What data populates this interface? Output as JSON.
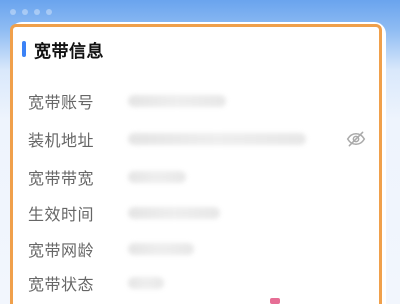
{
  "section": {
    "title": "宽带信息"
  },
  "rows": [
    {
      "label": "宽带账号"
    },
    {
      "label": "装机地址",
      "icon": "eye-hidden-icon"
    },
    {
      "label": "宽带带宽"
    },
    {
      "label": "生效时间"
    },
    {
      "label": "宽带网龄"
    },
    {
      "label": "宽带状态"
    }
  ],
  "colors": {
    "accent": "#3b82f6",
    "highlight_border": "#f0a04b",
    "label_text": "#666666",
    "title_text": "#111111"
  }
}
